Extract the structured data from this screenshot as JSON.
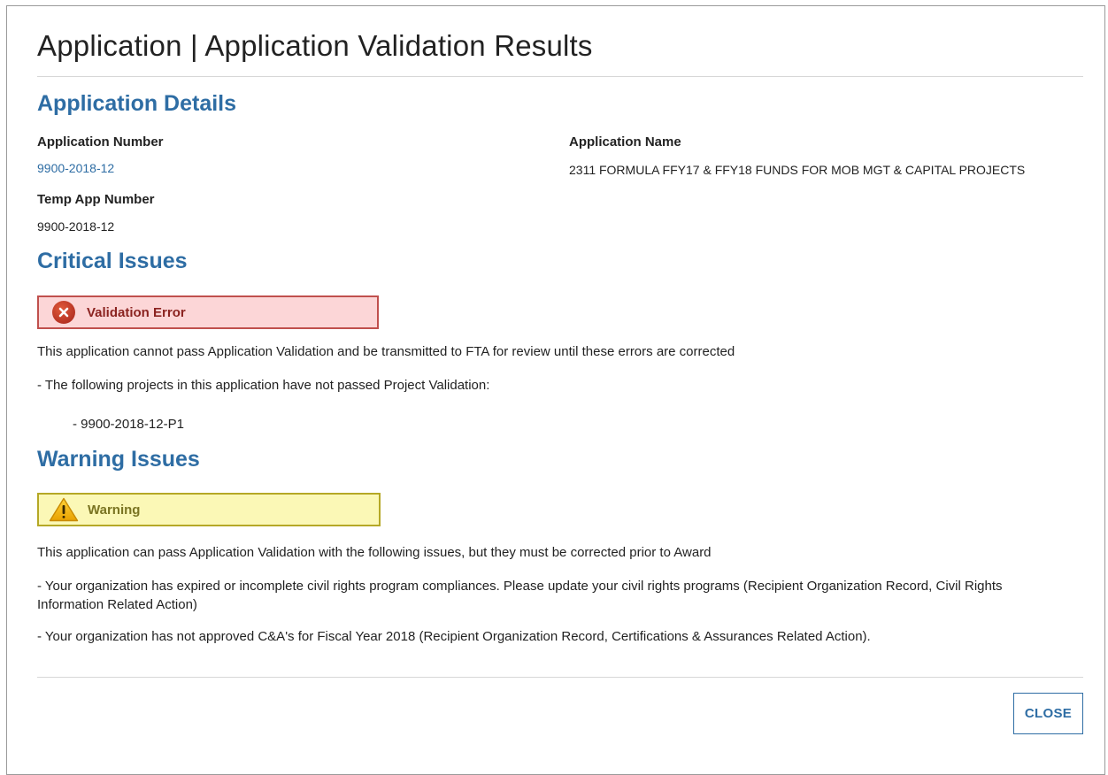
{
  "modal": {
    "title": "Application | Application Validation Results"
  },
  "details": {
    "heading": "Application Details",
    "application_number_label": "Application Number",
    "application_number_value": "9900-2018-12",
    "temp_app_number_label": "Temp App Number",
    "temp_app_number_value": "9900-2018-12",
    "application_name_label": "Application Name",
    "application_name_value": "2311 FORMULA FFY17 & FFY18 FUNDS FOR MOB MGT & CAPITAL PROJECTS"
  },
  "critical": {
    "heading": "Critical Issues",
    "alert_label": "Validation Error",
    "alert_icon": "error-x-icon",
    "alert_bg_color": "#fcd6d7",
    "alert_border_color": "#c0504d",
    "description": "This application cannot pass Application Validation and be transmitted to FTA for review until these errors are corrected",
    "items": [
      "- The following projects in this application have not passed Project Validation:"
    ],
    "sub_items": [
      "- 9900-2018-12-P1"
    ]
  },
  "warning": {
    "heading": "Warning Issues",
    "alert_label": "Warning",
    "alert_icon": "warning-triangle-icon",
    "alert_bg_color": "#fbf8b6",
    "alert_border_color": "#b5a826",
    "description": "This application can pass Application Validation with the following issues, but they must be corrected prior to Award",
    "items": [
      "- Your organization has expired or incomplete civil rights program compliances. Please update your civil rights programs (Recipient Organization Record, Civil Rights Information Related Action)",
      "- Your organization has not approved C&A's for Fiscal Year 2018 (Recipient Organization Record, Certifications & Assurances Related Action)."
    ]
  },
  "footer": {
    "close_label": "CLOSE"
  },
  "colors": {
    "heading_blue": "#2e6da4",
    "text": "#222222",
    "divider": "#d7d7d7"
  }
}
